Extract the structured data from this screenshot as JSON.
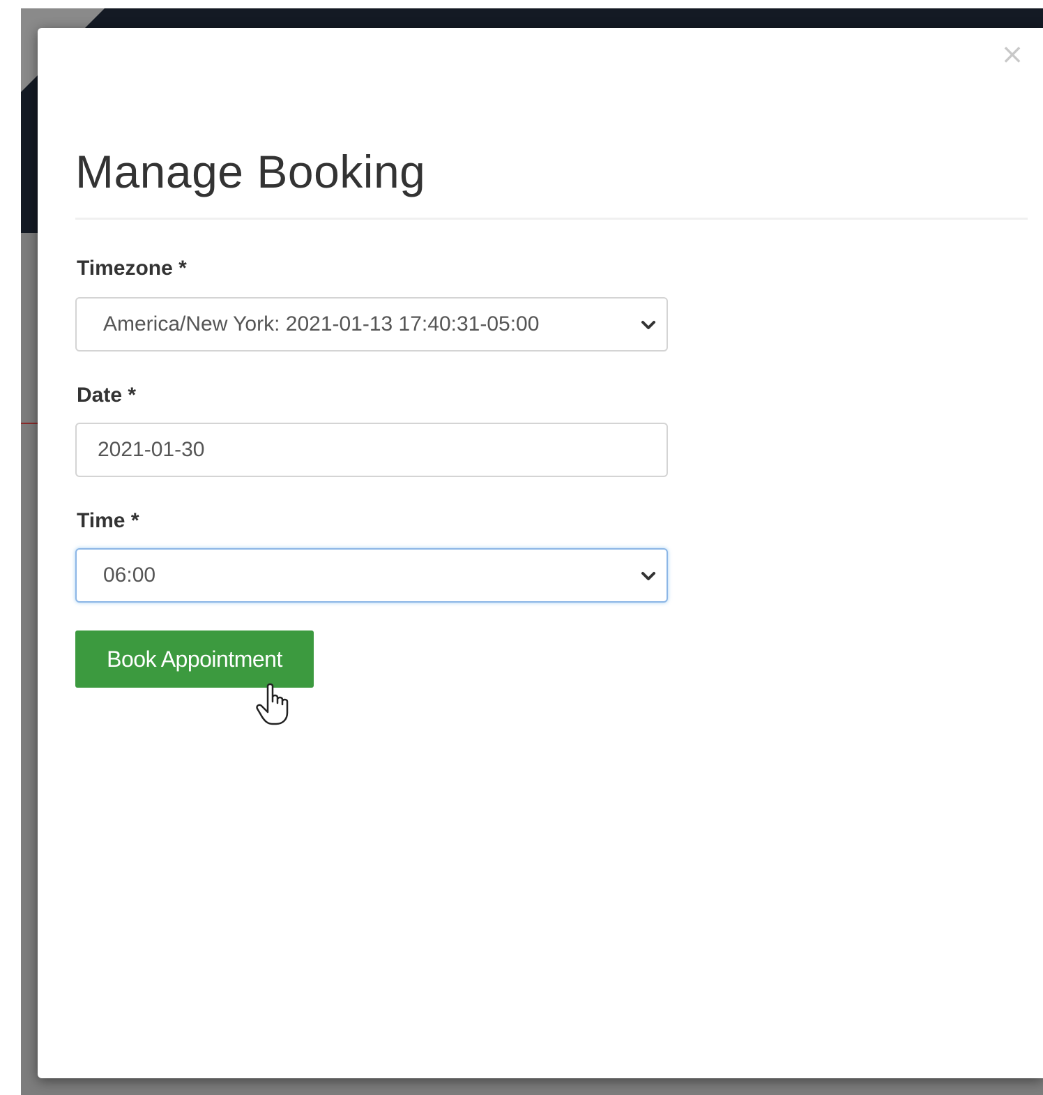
{
  "modal": {
    "title": "Manage Booking",
    "close_icon": "close-icon",
    "close_glyph": "×"
  },
  "form": {
    "timezone": {
      "label": "Timezone *",
      "selected": "America/New York: 2021-01-13 17:40:31-05:00",
      "icon": "chevron-down-icon"
    },
    "date": {
      "label": "Date *",
      "value": "2021-01-30"
    },
    "time": {
      "label": "Time *",
      "selected": "06:00",
      "icon": "chevron-down-icon"
    },
    "submit_label": "Book Appointment"
  },
  "colors": {
    "submit_button": "#3c9a3f",
    "backdrop": "#7d7d7d",
    "backdrop_header": "#141a24",
    "focus_ring": "#8cb6e6"
  },
  "cursor": {
    "icon": "hand-pointer-icon"
  }
}
